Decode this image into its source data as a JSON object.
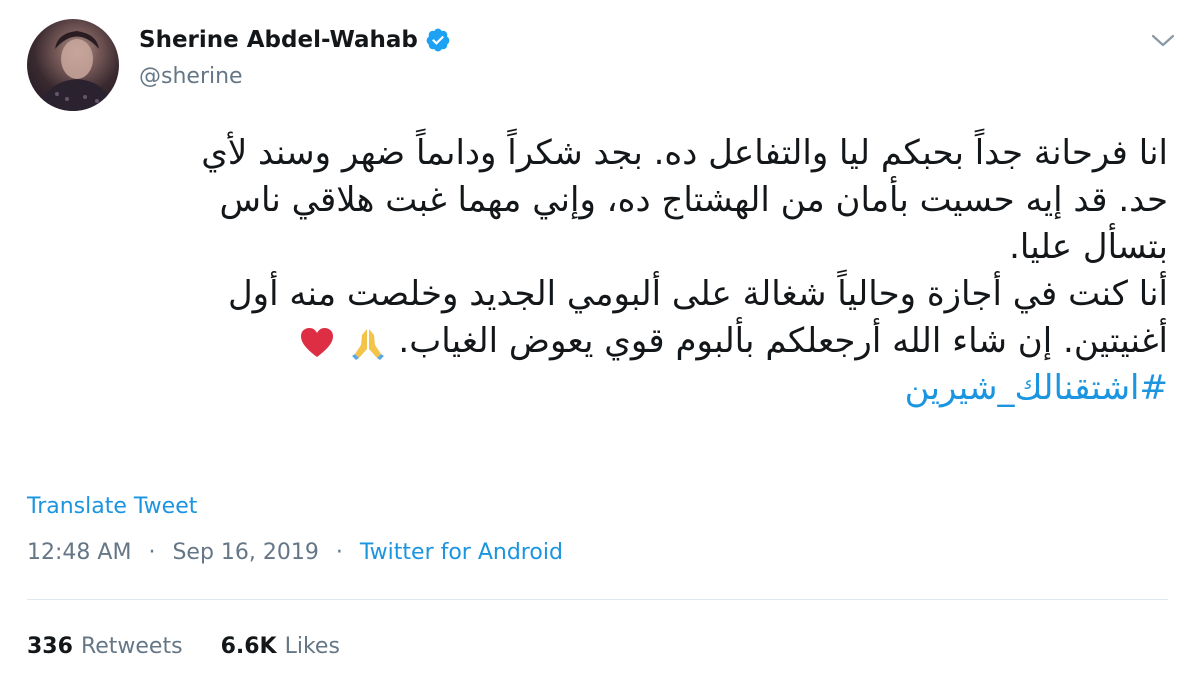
{
  "author": {
    "name": "Sherine Abdel-Wahab",
    "handle": "@sherine",
    "verified_icon": "verified-badge-icon",
    "accent_color": "#1da1f2"
  },
  "tweet": {
    "lines": [
      "انا فرحانة جداً بحبكم ليا والتفاعل ده. بجد شكراً وداىماً ضهر وسند لأي",
      "حد. قد إيه حسيت بأمان من الهشتاج ده، وإني مهما غبت هلاقي ناس",
      "بتسأل عليا.",
      "أنا كنت في أجازة وحالياً شغالة على ألبومي الجديد وخلصت منه أول",
      "أغنيتين. إن شاء الله أرجعلكم بألبوم قوي يعوض الغياب."
    ],
    "emojis": [
      "folded-hands-icon",
      "red-heart-icon"
    ],
    "hashtag": "#اشتقنالك_شيرين"
  },
  "translate_label": "Translate Tweet",
  "meta": {
    "time": "12:48 AM",
    "date": "Sep 16, 2019",
    "separator": "·",
    "source": "Twitter for Android"
  },
  "stats": {
    "retweets_count": "336",
    "retweets_label": "Retweets",
    "likes_count": "6.6K",
    "likes_label": "Likes"
  },
  "colors": {
    "link": "#1b95e0",
    "secondary_text": "#657786",
    "primary_text": "#14171a",
    "divider": "#e1e8ed"
  }
}
